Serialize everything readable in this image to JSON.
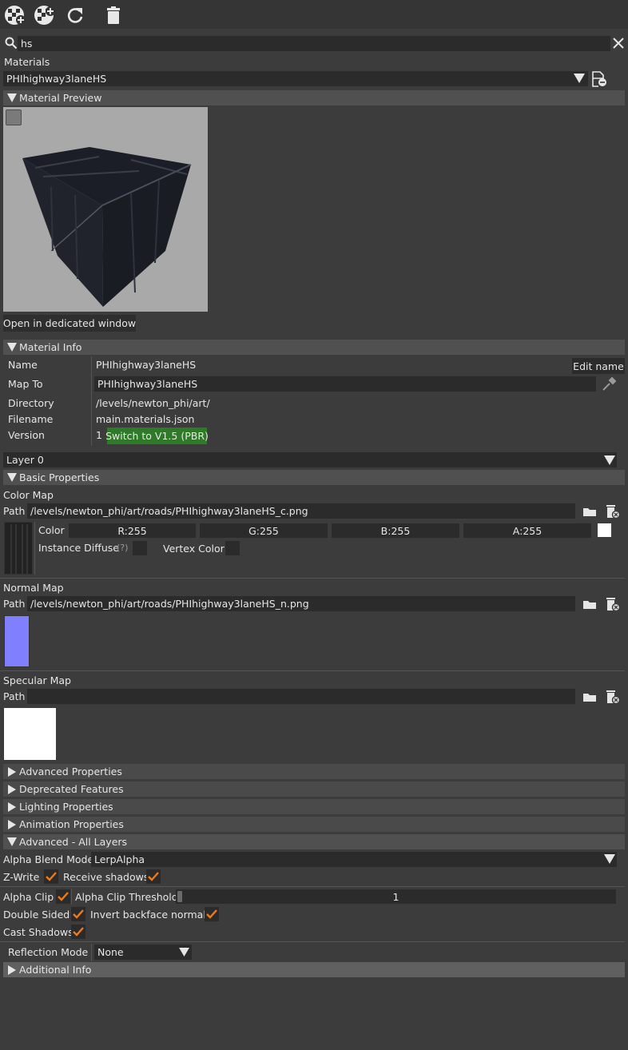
{
  "toolbar": {
    "icons": [
      "add-material-icon",
      "add-material-alt-icon",
      "refresh-icon",
      "trash-icon"
    ]
  },
  "search": {
    "value": "hs"
  },
  "materials": {
    "label": "Materials",
    "selected": "PHIhighway3laneHS"
  },
  "preview": {
    "header": "Material Preview",
    "open_button": "Open in dedicated window"
  },
  "info": {
    "header": "Material Info",
    "edit_name_button": "Edit name",
    "rows": {
      "name_label": "Name",
      "name_value": "PHIhighway3laneHS",
      "mapto_label": "Map To",
      "mapto_value": "PHIhighway3laneHS",
      "directory_label": "Directory",
      "directory_value": "/levels/newton_phi/art/",
      "filename_label": "Filename",
      "filename_value": "main.materials.json",
      "version_label": "Version",
      "version_value": "1",
      "switch_button": "Switch to V1.5 (PBR)"
    }
  },
  "layer": {
    "selected": "Layer 0"
  },
  "basic": {
    "header": "Basic Properties",
    "color_map": {
      "title": "Color Map",
      "path_label": "Path",
      "path": "/levels/newton_phi/art/roads/PHIhighway3laneHS_c.png",
      "color_label": "Color",
      "r": "R:255",
      "g": "G:255",
      "b": "B:255",
      "a": "A:255",
      "instance_diffuse_label": "Instance Diffuse",
      "help": "(?)",
      "vertex_color_label": "Vertex Color"
    },
    "normal_map": {
      "title": "Normal Map",
      "path_label": "Path",
      "path": "/levels/newton_phi/art/roads/PHIhighway3laneHS_n.png"
    },
    "specular_map": {
      "title": "Specular Map",
      "path_label": "Path",
      "path": ""
    }
  },
  "sections": {
    "advanced_properties": "Advanced Properties",
    "deprecated_features": "Deprecated Features",
    "lighting_properties": "Lighting Properties",
    "animation_properties": "Animation Properties",
    "advanced_all_layers": "Advanced - All Layers",
    "additional_info": "Additional Info"
  },
  "advanced_all": {
    "alpha_blend_label": "Alpha Blend Mode",
    "alpha_blend_value": "LerpAlpha",
    "zwrite_label": "Z-Write",
    "zwrite": true,
    "receive_shadows_label": "Receive shadows",
    "receive_shadows": true,
    "alpha_clip_label": "Alpha Clip",
    "alpha_clip": true,
    "alpha_clip_threshold_label": "Alpha Clip Threshold",
    "alpha_clip_threshold_value": "1",
    "alpha_clip_threshold_fraction": 0.0,
    "double_sided_label": "Double Sided",
    "double_sided": true,
    "invert_backface_label": "Invert backface normals",
    "invert_backface": true,
    "cast_shadows_label": "Cast Shadows",
    "cast_shadows": true,
    "reflection_mode_label": "Reflection Mode",
    "reflection_mode_value": "None"
  },
  "colors": {
    "check": "#f07a1a",
    "green_button": "#2f7a28",
    "normal_swatch": "#8080ff",
    "specular_swatch": "#ffffff",
    "preview_bg": "#a9a9a9"
  }
}
